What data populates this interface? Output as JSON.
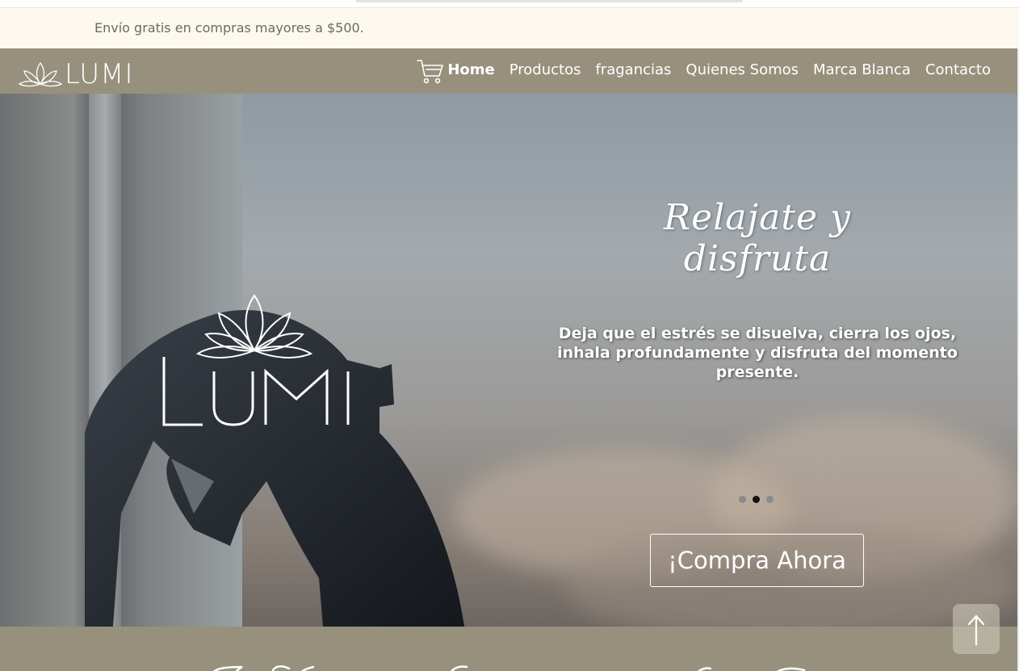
{
  "announcement": {
    "text": "Envío gratis en compras mayores a $500."
  },
  "brand": {
    "name": "LUMI",
    "logo_icon": "lotus-icon"
  },
  "nav": {
    "cart_icon": "cart-icon",
    "links": [
      {
        "label": "Home",
        "active": true
      },
      {
        "label": "Productos",
        "active": false
      },
      {
        "label": "fragancias",
        "active": false
      },
      {
        "label": "Quienes Somos",
        "active": false
      },
      {
        "label": "Marca Blanca",
        "active": false
      },
      {
        "label": "Contacto",
        "active": false
      }
    ]
  },
  "hero": {
    "script_title": "Relajate y disfruta",
    "text": "Deja que el estrés se disuelva, cierra los ojos, inhala profundamente y disfruta del momento presente.",
    "cta_label": "¡Compra Ahora",
    "slides": {
      "count": 3,
      "active_index": 1
    }
  },
  "back_to_top_icon": "arrow-up-icon",
  "colors": {
    "announcement_bg": "#fdf9ee",
    "navbar_bg": "#97907d",
    "text_light": "#ffffff"
  }
}
